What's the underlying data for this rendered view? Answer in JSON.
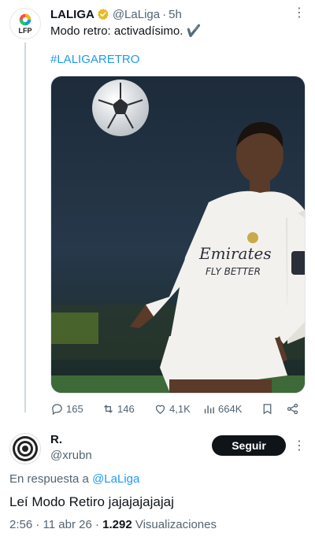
{
  "tweet": {
    "name": "LALIGA",
    "handle": "@LaLiga",
    "separator": "·",
    "time": "5h",
    "text": "Modo retro: activadísimo. ✔️",
    "hashtag": "#LALIGARETRO",
    "avatar_text": "LFP",
    "jersey_text_1": "Emirates",
    "jersey_text_2": "FLY BETTER"
  },
  "actions": {
    "replies": "165",
    "retweets": "146",
    "likes": "4,1K",
    "views": "664K"
  },
  "reply": {
    "name": "R.",
    "handle": "@xrubn",
    "follow_label": "Seguir",
    "in_reply_prefix": "En respuesta a",
    "in_reply_mention": "@LaLiga",
    "text": "Leí Modo Retiro jajajajajajaj",
    "time": "2:56 · 11 abr 26 ·",
    "views_count": "1.292",
    "views_label": "Visualizaciones"
  },
  "colors": {
    "accent": "#1d9bf0",
    "secondary_text": "#536471",
    "primary_text": "#0f1419",
    "verified": "#e8b923"
  }
}
